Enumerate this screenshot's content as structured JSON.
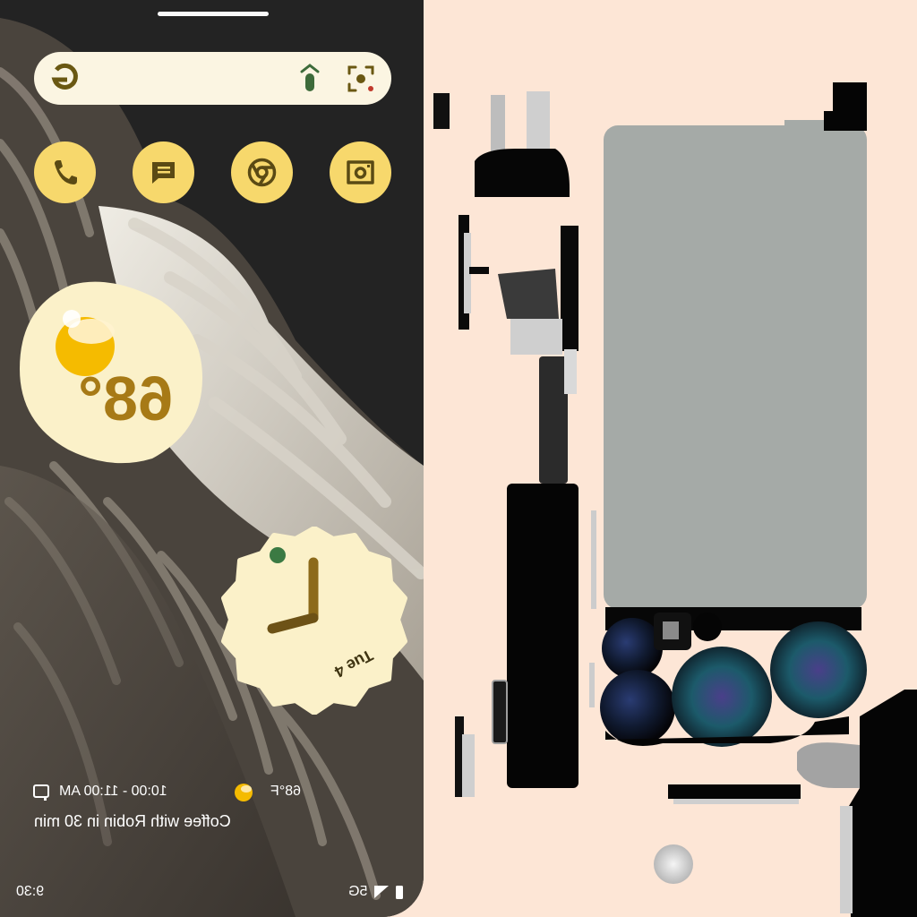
{
  "colors": {
    "background": "#fde6d6",
    "phone_bg": "#232323",
    "accent_yellow": "#f7d86c",
    "widget_cream": "#fbf1c9",
    "brown": "#8c6a1a"
  },
  "search_bar": {
    "google_icon": "google-g-icon",
    "mic_icon": "microphone-icon",
    "lens_icon": "camera-lens-icon"
  },
  "dock": {
    "apps": [
      {
        "name": "Phone",
        "icon": "phone-icon"
      },
      {
        "name": "Messages",
        "icon": "message-icon"
      },
      {
        "name": "Chrome",
        "icon": "chrome-icon"
      },
      {
        "name": "Camera",
        "icon": "camera-icon"
      }
    ]
  },
  "weather_widget": {
    "temperature": "68°"
  },
  "clock_widget": {
    "date": "Tue 4"
  },
  "at_a_glance": {
    "event_time": "10:00 - 11:00 AM",
    "temperature": "68°F",
    "event_title": "Coffee with Robin in 30 min"
  },
  "status_bar": {
    "time": "9:30",
    "network": "5G"
  }
}
